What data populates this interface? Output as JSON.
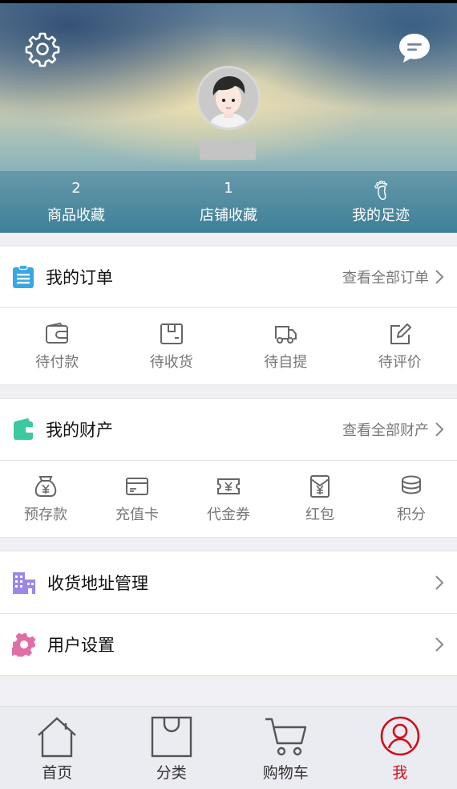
{
  "profile": {
    "stats": [
      {
        "value": "2",
        "label": "商品收藏"
      },
      {
        "value": "1",
        "label": "店铺收藏"
      },
      {
        "value": "",
        "label": "我的足迹"
      }
    ]
  },
  "orders": {
    "title": "我的订单",
    "more": "查看全部订单",
    "items": [
      {
        "label": "待付款",
        "icon": "wallet-icon"
      },
      {
        "label": "待收货",
        "icon": "package-icon"
      },
      {
        "label": "待自提",
        "icon": "truck-icon"
      },
      {
        "label": "待评价",
        "icon": "edit-icon"
      }
    ]
  },
  "assets": {
    "title": "我的财产",
    "more": "查看全部财产",
    "items": [
      {
        "label": "预存款",
        "icon": "money-bag-icon"
      },
      {
        "label": "充值卡",
        "icon": "card-icon"
      },
      {
        "label": "代金券",
        "icon": "voucher-icon"
      },
      {
        "label": "红包",
        "icon": "red-envelope-icon"
      },
      {
        "label": "积分",
        "icon": "coins-icon"
      }
    ]
  },
  "menu": {
    "address": "收货地址管理",
    "settings": "用户设置"
  },
  "tabbar": {
    "items": [
      {
        "label": "首页",
        "icon": "home-icon"
      },
      {
        "label": "分类",
        "icon": "category-bag-icon"
      },
      {
        "label": "购物车",
        "icon": "cart-icon"
      },
      {
        "label": "我",
        "icon": "user-icon",
        "active": true
      }
    ]
  },
  "colors": {
    "accent": "#d0101a",
    "order_icon": "#3aa7e0",
    "asset_icon": "#3cc9a0",
    "address_icon": "#9b87e8",
    "settings_icon": "#e06fa8",
    "grid_icon": "#666666"
  }
}
